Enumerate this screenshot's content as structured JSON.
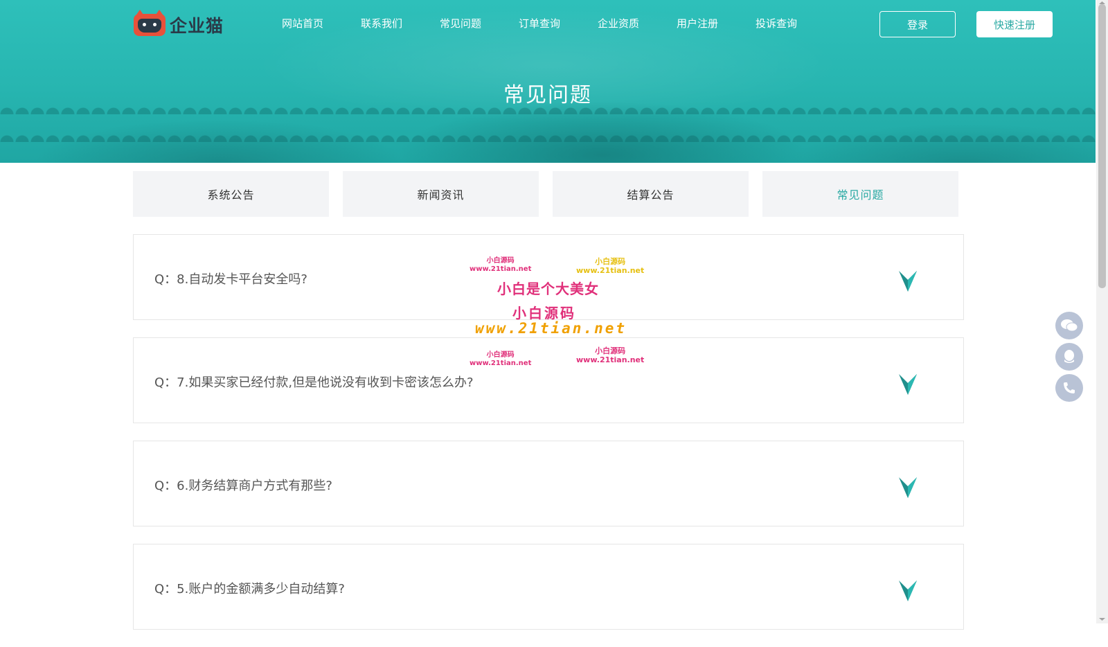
{
  "header": {
    "logo_text": "企业猫",
    "nav": [
      "网站首页",
      "联系我们",
      "常见问题",
      "订单查询",
      "企业资质",
      "用户注册",
      "投诉查询"
    ],
    "login_label": "登录",
    "register_label": "快速注册"
  },
  "hero": {
    "title": "常见问题"
  },
  "tabs": [
    {
      "label": "系统公告",
      "active": false
    },
    {
      "label": "新闻资讯",
      "active": false
    },
    {
      "label": "结算公告",
      "active": false
    },
    {
      "label": "常见问题",
      "active": true
    }
  ],
  "faq": [
    {
      "question": "Q：8.自动发卡平台安全吗?"
    },
    {
      "question": "Q：7.如果买家已经付款,但是他说没有收到卡密该怎么办?"
    },
    {
      "question": "Q：6.财务结算商户方式有那些?"
    },
    {
      "question": "Q：5.账户的金额满多少自动结算?"
    }
  ],
  "watermark": {
    "brand_small": "小白源码",
    "url_small": "www.21tian.net",
    "slogan": "小白是个大美女",
    "brand_big": "小白源码",
    "url_big": "www.21tian.net"
  },
  "float_buttons": [
    "wechat-icon",
    "qq-icon",
    "phone-icon"
  ],
  "colors": {
    "accent": "#2aa9a3",
    "hero": "#27b5b0",
    "float": "#b9c3d6",
    "watermark_pink": "#e0307a",
    "watermark_yellow": "#e6c012"
  }
}
